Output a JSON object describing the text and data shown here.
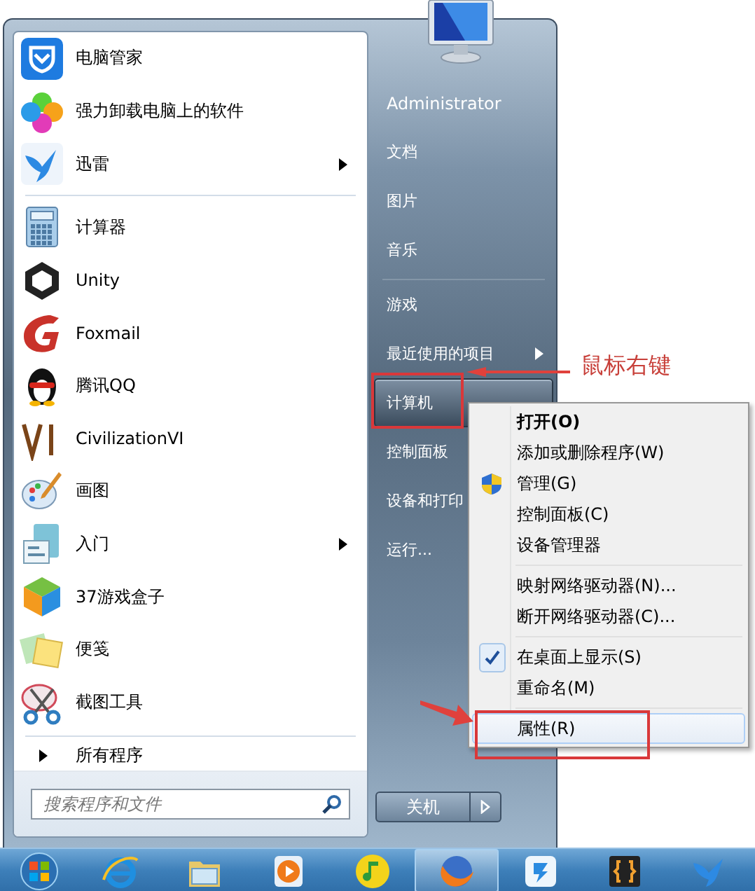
{
  "start_menu": {
    "pinned": [
      {
        "label": "电脑管家",
        "kind": "shield",
        "submenu": false,
        "selected": false
      },
      {
        "label": "强力卸载电脑上的软件",
        "kind": "petals",
        "submenu": false,
        "selected": false
      },
      {
        "label": "迅雷",
        "kind": "bird",
        "submenu": true,
        "selected": false
      }
    ],
    "recent": [
      {
        "label": "计算器",
        "kind": "calculator",
        "submenu": false,
        "selected": false
      },
      {
        "label": "Unity",
        "kind": "cube_outline",
        "submenu": false,
        "selected": false
      },
      {
        "label": "Foxmail",
        "kind": "ribbon",
        "submenu": false,
        "selected": false
      },
      {
        "label": "腾讯QQ",
        "kind": "penguin",
        "submenu": false,
        "selected": false
      },
      {
        "label": "CivilizationVI",
        "kind": "emblem",
        "submenu": false,
        "selected": false
      },
      {
        "label": "画图",
        "kind": "palette",
        "submenu": false,
        "selected": false
      },
      {
        "label": "入门",
        "kind": "document",
        "submenu": true,
        "selected": false
      },
      {
        "label": "37游戏盒子",
        "kind": "cube",
        "submenu": false,
        "selected": false
      },
      {
        "label": "便笺",
        "kind": "notes",
        "submenu": false,
        "selected": false
      },
      {
        "label": "截图工具",
        "kind": "scissors",
        "submenu": false,
        "selected": false
      }
    ],
    "all_programs": "所有程序",
    "search": {
      "placeholder": "搜索程序和文件"
    },
    "user": "Administrator",
    "folders": [
      {
        "label": "文档",
        "submenu": false,
        "selected": false
      },
      {
        "label": "图片",
        "submenu": false,
        "selected": false
      },
      {
        "label": "音乐",
        "submenu": false,
        "selected": false
      }
    ],
    "system": [
      {
        "label": "游戏",
        "submenu": false,
        "selected": false
      },
      {
        "label": "最近使用的项目",
        "submenu": true,
        "selected": false
      },
      {
        "label": "计算机",
        "submenu": false,
        "selected": true
      },
      {
        "label": "控制面板",
        "submenu": false,
        "selected": false
      },
      {
        "label": "设备和打印",
        "submenu": false,
        "selected": false
      },
      {
        "label": "运行...",
        "submenu": false,
        "selected": false
      }
    ],
    "shutdown": "关机"
  },
  "context_menu": {
    "groups": [
      [
        {
          "label": "打开(O)",
          "default": true,
          "kind": "plain",
          "checked": false,
          "selected": false
        },
        {
          "label": "添加或删除程序(W)",
          "default": false,
          "kind": "plain",
          "checked": false,
          "selected": false
        },
        {
          "label": "管理(G)",
          "default": false,
          "kind": "shield",
          "checked": false,
          "selected": false
        },
        {
          "label": "控制面板(C)",
          "default": false,
          "kind": "plain",
          "checked": false,
          "selected": false
        },
        {
          "label": "设备管理器",
          "default": false,
          "kind": "plain",
          "checked": false,
          "selected": false
        }
      ],
      [
        {
          "label": "映射网络驱动器(N)...",
          "default": false,
          "kind": "plain",
          "checked": false,
          "selected": false
        },
        {
          "label": "断开网络驱动器(C)...",
          "default": false,
          "kind": "plain",
          "checked": false,
          "selected": false
        }
      ],
      [
        {
          "label": "在桌面上显示(S)",
          "default": false,
          "kind": "plain",
          "checked": true,
          "selected": false
        },
        {
          "label": "重命名(M)",
          "default": false,
          "kind": "plain",
          "checked": false,
          "selected": false
        }
      ],
      [
        {
          "label": "属性(R)",
          "default": false,
          "kind": "plain",
          "checked": false,
          "selected": true
        }
      ]
    ]
  },
  "annotation": {
    "label": "鼠标右键"
  },
  "taskbar": {
    "apps": [
      {
        "kind": "orb",
        "selected": false
      },
      {
        "kind": "browser",
        "selected": false
      },
      {
        "kind": "folder",
        "selected": false
      },
      {
        "kind": "player",
        "selected": false
      },
      {
        "kind": "music",
        "selected": false
      },
      {
        "kind": "globe",
        "selected": true
      },
      {
        "kind": "app",
        "selected": false
      },
      {
        "kind": "braces",
        "selected": false
      },
      {
        "kind": "bird",
        "selected": false
      }
    ]
  }
}
